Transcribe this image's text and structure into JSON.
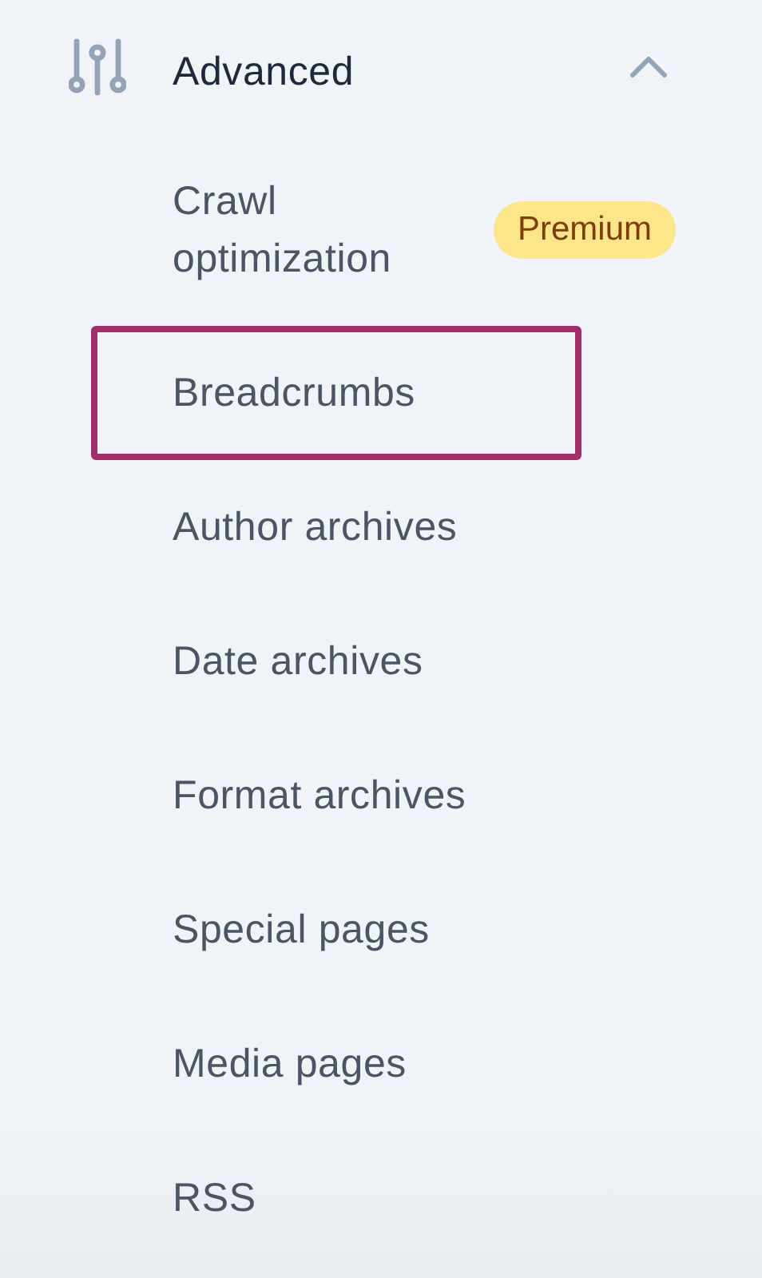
{
  "section": {
    "title": "Advanced",
    "expanded": true
  },
  "items": [
    {
      "label": "Crawl optimization",
      "badge": "Premium",
      "highlighted": false
    },
    {
      "label": "Breadcrumbs",
      "highlighted": true
    },
    {
      "label": "Author archives",
      "highlighted": false
    },
    {
      "label": "Date archives",
      "highlighted": false
    },
    {
      "label": "Format archives",
      "highlighted": false
    },
    {
      "label": "Special pages",
      "highlighted": false
    },
    {
      "label": "Media pages",
      "highlighted": false
    },
    {
      "label": "RSS",
      "highlighted": false
    }
  ]
}
